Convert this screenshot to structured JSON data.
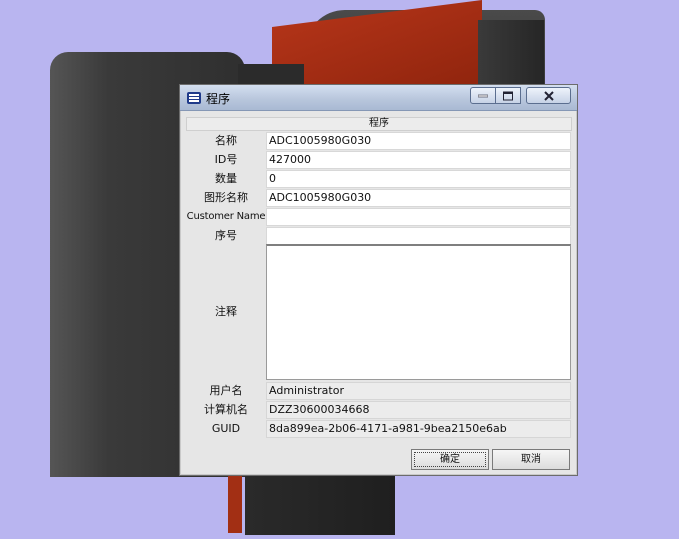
{
  "window": {
    "title": "程序",
    "icon": "program-app-icon",
    "controls": [
      "minimize-icon",
      "maximize-icon",
      "close-icon"
    ]
  },
  "section": {
    "header": "程序"
  },
  "fields": [
    {
      "key": "name",
      "label": "名称",
      "value": "ADC1005980G030"
    },
    {
      "key": "id",
      "label": "ID号",
      "value": "427000"
    },
    {
      "key": "quantity",
      "label": "数量",
      "value": "0"
    },
    {
      "key": "drawing_name",
      "label": "图形名称",
      "value": "ADC1005980G030"
    },
    {
      "key": "customer_name",
      "label": "Customer Name",
      "value": ""
    },
    {
      "key": "serial",
      "label": "序号",
      "value": ""
    }
  ],
  "notes": {
    "label": "注释",
    "value": ""
  },
  "info": [
    {
      "key": "user",
      "label": "用户名",
      "value": "Administrator"
    },
    {
      "key": "computer",
      "label": "计算机名",
      "value": "DZZ30600034668"
    },
    {
      "key": "guid",
      "label": "GUID",
      "value": "8da899ea-2b06-4171-a981-9bea2150e6ab"
    }
  ],
  "buttons": {
    "ok": "确定",
    "cancel": "取消"
  },
  "colors": {
    "viewport_bg": "#b9b5f0",
    "red_part": "#a22f14",
    "dark_part": "#2f2f2f"
  }
}
